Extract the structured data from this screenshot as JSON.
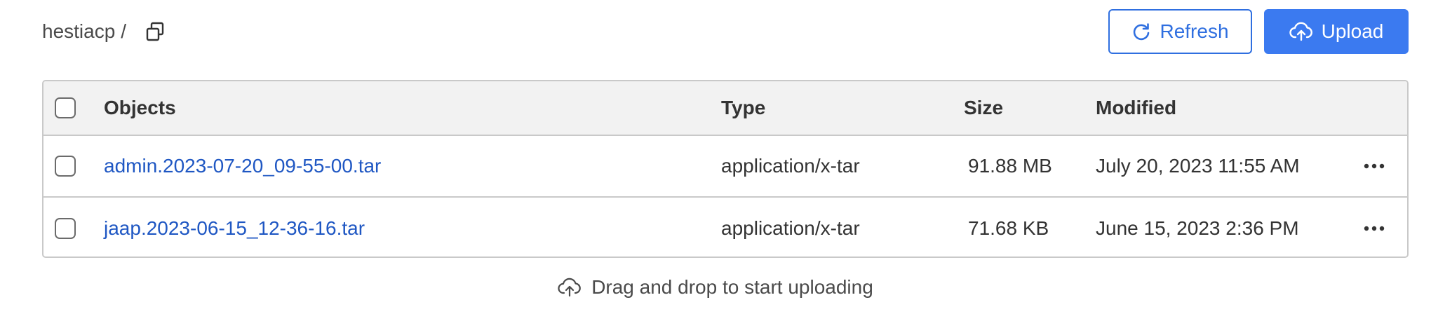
{
  "breadcrumb": {
    "root": "hestiacp",
    "separator": "/",
    "copy_icon": "copy-icon"
  },
  "toolbar": {
    "refresh_label": "Refresh",
    "refresh_icon": "refresh-icon",
    "upload_label": "Upload",
    "upload_icon": "cloud-upload-icon",
    "accent_color": "#3b7af0"
  },
  "table": {
    "columns": {
      "objects": "Objects",
      "type": "Type",
      "size": "Size",
      "modified": "Modified"
    },
    "rows": [
      {
        "name": "admin.2023-07-20_09-55-00.tar",
        "type": "application/x-tar",
        "size": "91.88 MB",
        "modified": "July 20, 2023 11:55 AM"
      },
      {
        "name": "jaap.2023-06-15_12-36-16.tar",
        "type": "application/x-tar",
        "size": "71.68 KB",
        "modified": "June 15, 2023 2:36 PM"
      }
    ]
  },
  "dropzone": {
    "label": "Drag and drop to start uploading",
    "icon": "cloud-upload-icon"
  }
}
